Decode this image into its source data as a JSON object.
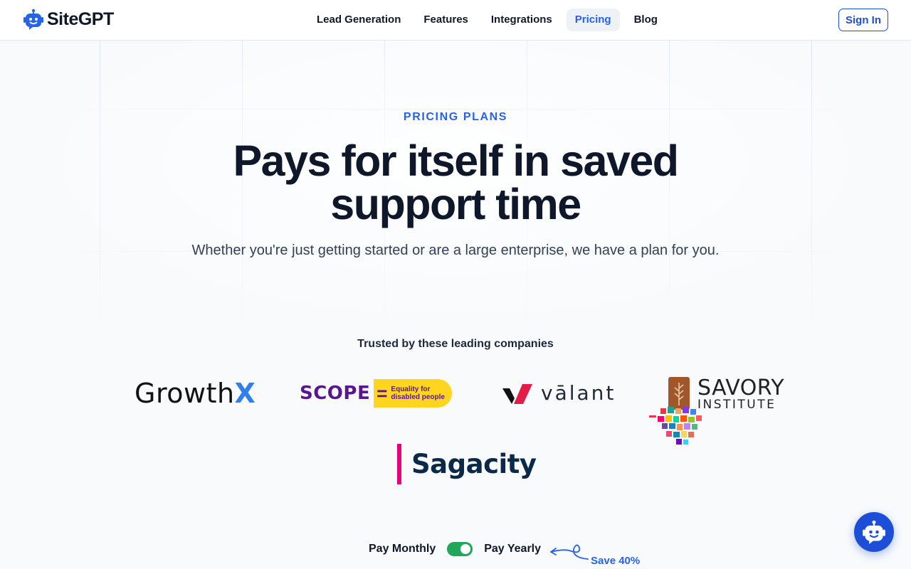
{
  "brand": {
    "name": "SiteGPT",
    "accent": "#2563eb"
  },
  "nav": {
    "items": [
      {
        "label": "Lead Generation",
        "active": false
      },
      {
        "label": "Features",
        "active": false
      },
      {
        "label": "Integrations",
        "active": false
      },
      {
        "label": "Pricing",
        "active": true
      },
      {
        "label": "Blog",
        "active": false
      }
    ],
    "signin_label": "Sign In"
  },
  "hero": {
    "eyebrow": "PRICING PLANS",
    "headline": "Pays for itself in saved support time",
    "subhead": "Whether you're just getting started or are a large enterprise, we have a plan for you."
  },
  "trusted": {
    "heading": "Trusted by these leading companies",
    "logos": {
      "growthx": {
        "text_main": "Growth",
        "text_accent": "X"
      },
      "scope": {
        "word": "SCOPE",
        "equals": "=",
        "tagline_1": "Equality for",
        "tagline_2": "disabled people"
      },
      "valant": {
        "word": "vālant"
      },
      "savory": {
        "word": "SAVORY",
        "sub": "INSTITUTE"
      },
      "sagacity": {
        "word": "Sagacity"
      }
    }
  },
  "billing": {
    "monthly_label": "Pay Monthly",
    "yearly_label": "Pay Yearly",
    "yearly_selected": true,
    "save_text": "Save 40%"
  },
  "icons": {
    "brand": "robot-logo-icon",
    "chat": "robot-chat-icon",
    "save_arrow": "curly-arrow-icon"
  }
}
